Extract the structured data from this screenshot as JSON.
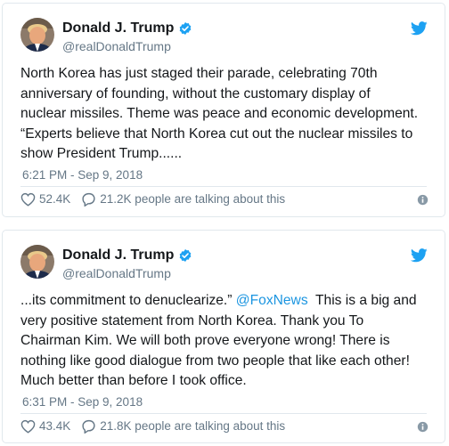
{
  "colors": {
    "link": "#1b95e0",
    "secondary_text": "#657786",
    "border": "#e1e8ed",
    "verified_badge": "#1da1f2",
    "twitter_logo": "#1da1f2"
  },
  "icons": [
    "avatar",
    "verified-badge-icon",
    "twitter-bird-icon",
    "heart-icon",
    "speech-bubble-icon",
    "info-icon"
  ],
  "tweets": [
    {
      "display_name": "Donald J. Trump",
      "handle": "@realDonaldTrump",
      "lines": [
        "North Korea has just staged their parade, celebrating 70th",
        "anniversary of founding, without the customary display of",
        "nuclear missiles. Theme was peace and economic development.",
        "“Experts believe that North Korea cut out the nuclear missiles to",
        "show President Trump......"
      ],
      "timestamp": "6:21 PM - Sep 9, 2018",
      "likes": "52.4K",
      "talking": "21.2K people are talking about this"
    },
    {
      "display_name": "Donald J. Trump",
      "handle": "@realDonaldTrump",
      "line0_before": "...its commitment to denuclearize.” ",
      "line0_mention": "@FoxNews",
      "line0_after": "  This is a big and",
      "lines": [
        "very positive statement from North Korea. Thank you To",
        "Chairman Kim. We will both prove everyone wrong! There is",
        "nothing like good dialogue from two people that like each other!",
        "Much better than before I took office."
      ],
      "timestamp": "6:31 PM - Sep 9, 2018",
      "likes": "43.4K",
      "talking": "21.8K people are talking about this"
    }
  ]
}
